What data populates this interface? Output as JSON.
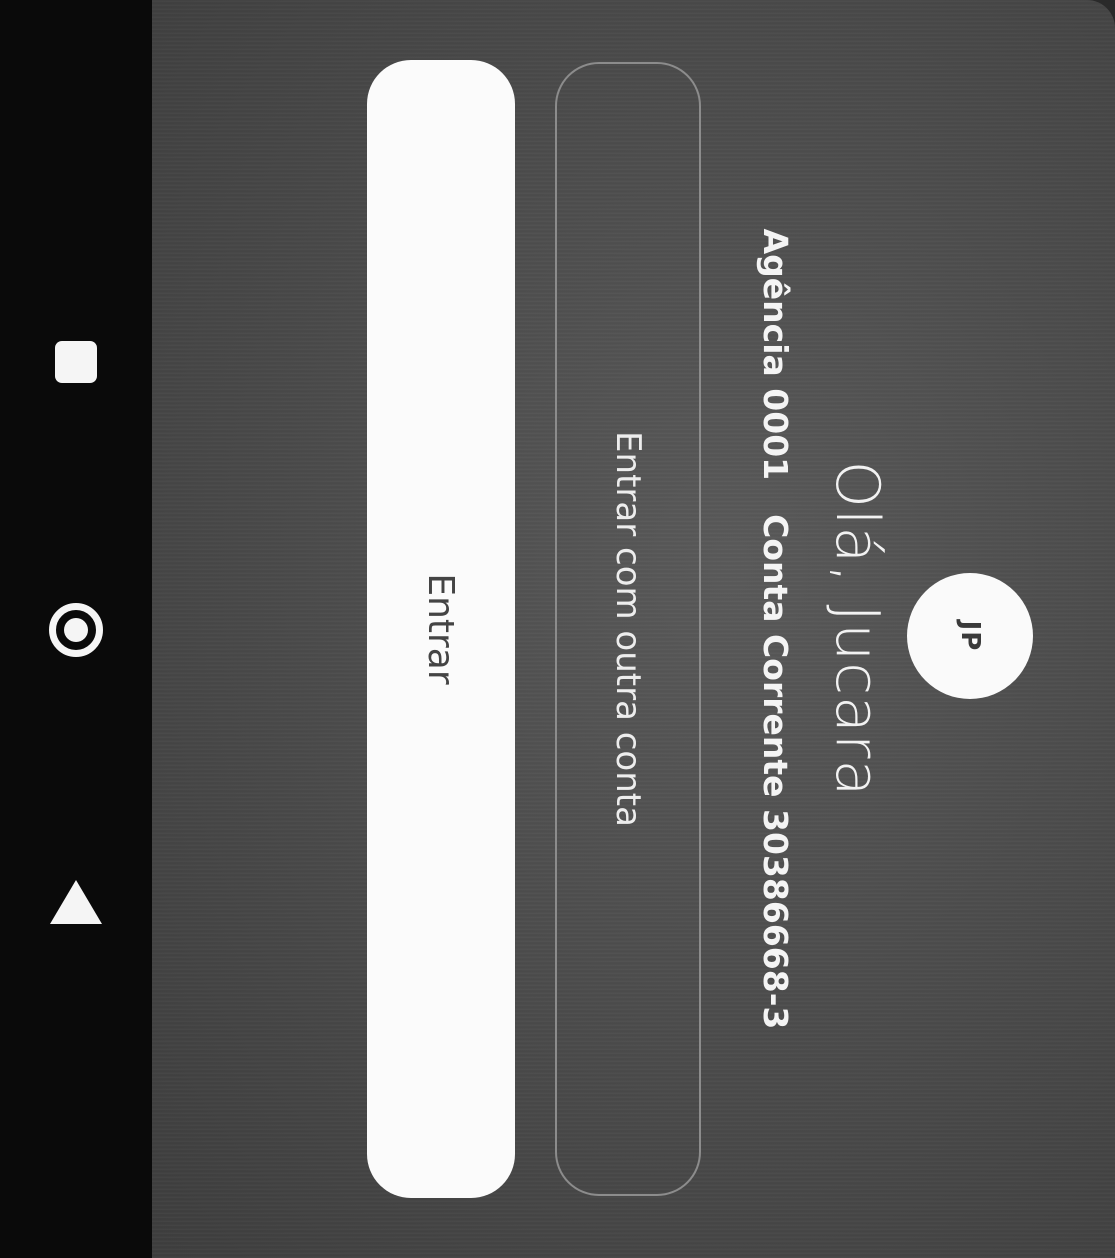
{
  "navigation_bar": {
    "items": [
      {
        "icon": "recents-square-icon"
      },
      {
        "icon": "home-circle-icon"
      },
      {
        "icon": "back-triangle-icon"
      }
    ]
  },
  "login": {
    "avatar_initials": "JP",
    "greeting": "Olá, Jucara",
    "agency_label": "Agência 0001",
    "account_label": "Conta Corrente 30386668-3",
    "other_account_button": "Entrar com outra conta",
    "enter_button": "Entrar"
  },
  "colors": {
    "background": "#4a4a4a",
    "navbar": "#0a0a0a",
    "primary_button": "#fbfbfb",
    "outline": "#8c8c8c",
    "text_light": "#f2f2f2"
  }
}
